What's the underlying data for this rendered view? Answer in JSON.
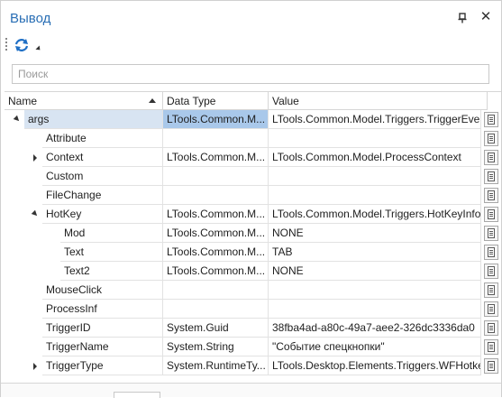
{
  "panel": {
    "title": "Вывод"
  },
  "search": {
    "placeholder": "Поиск"
  },
  "columns": [
    "Name",
    "Data Type",
    "Value"
  ],
  "rows": [
    {
      "name": "args",
      "type": "LTools.Common.M...",
      "value": "LTools.Common.Model.Triggers.TriggerEvent",
      "expander": "down",
      "level": 0,
      "selected": true,
      "has_button": true
    },
    {
      "name": "Attribute",
      "type": "",
      "value": "",
      "expander": "none",
      "level": 1,
      "selected": false,
      "has_button": true
    },
    {
      "name": "Context",
      "type": "LTools.Common.M...",
      "value": "LTools.Common.Model.ProcessContext",
      "expander": "right",
      "level": 1,
      "selected": false,
      "has_button": true
    },
    {
      "name": "Custom",
      "type": "",
      "value": "",
      "expander": "none",
      "level": 1,
      "selected": false,
      "has_button": true
    },
    {
      "name": "FileChange",
      "type": "",
      "value": "",
      "expander": "none",
      "level": 1,
      "selected": false,
      "has_button": true
    },
    {
      "name": "HotKey",
      "type": "LTools.Common.M...",
      "value": "LTools.Common.Model.Triggers.HotKeyInfo",
      "expander": "down",
      "level": 1,
      "selected": false,
      "has_button": true
    },
    {
      "name": "Mod",
      "type": "LTools.Common.M...",
      "value": "NONE",
      "expander": "none",
      "level": 2,
      "selected": false,
      "has_button": true
    },
    {
      "name": "Text",
      "type": "LTools.Common.M...",
      "value": "TAB",
      "expander": "none",
      "level": 2,
      "selected": false,
      "has_button": true
    },
    {
      "name": "Text2",
      "type": "LTools.Common.M...",
      "value": "NONE",
      "expander": "none",
      "level": 2,
      "selected": false,
      "has_button": true
    },
    {
      "name": "MouseClick",
      "type": "",
      "value": "",
      "expander": "none",
      "level": 1,
      "selected": false,
      "has_button": true
    },
    {
      "name": "ProcessInf",
      "type": "",
      "value": "",
      "expander": "none",
      "level": 1,
      "selected": false,
      "has_button": true
    },
    {
      "name": "TriggerID",
      "type": "System.Guid",
      "value": "38fba4ad-a80c-49a7-aee2-326dc3336da0",
      "expander": "none",
      "level": 1,
      "selected": false,
      "has_button": true
    },
    {
      "name": "TriggerName",
      "type": "System.String",
      "value": "\"Событие спецкнопки\"",
      "expander": "none",
      "level": 1,
      "selected": false,
      "has_button": true
    },
    {
      "name": "TriggerType",
      "type": "System.RuntimeTy...",
      "value": "LTools.Desktop.Elements.Triggers.WFHotkey",
      "expander": "right",
      "level": 1,
      "selected": false,
      "has_button": true
    }
  ],
  "icons": {
    "pin": "pin-icon",
    "close": "close-icon",
    "refresh": "refresh-icon",
    "doc": "document-icon"
  },
  "colors": {
    "title": "#2a6fb5",
    "selection": "#d8e4f2"
  }
}
